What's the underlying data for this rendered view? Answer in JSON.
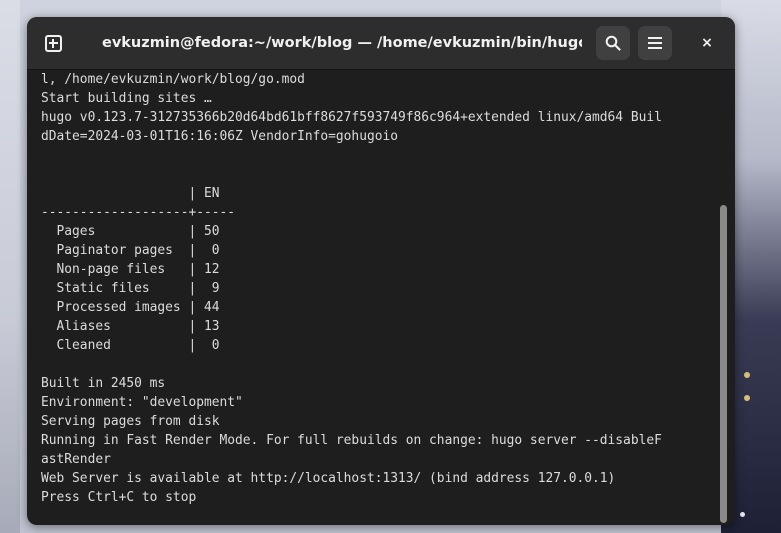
{
  "window": {
    "title": "evkuzmin@fedora:~/work/blog — /home/evkuzmin/bin/hugo se…",
    "close_label": "×"
  },
  "icons": {
    "new_tab": "new-tab-icon",
    "search": "search-icon",
    "menu": "hamburger-menu-icon",
    "close": "close-icon"
  },
  "terminal": {
    "lines": [
      "l, /home/evkuzmin/work/blog/go.mod",
      "Start building sites …",
      "hugo v0.123.7-312735366b20d64bd61bff8627f593749f86c964+extended linux/amd64 Buil",
      "dDate=2024-03-01T16:16:06Z VendorInfo=gohugoio",
      "",
      "",
      "                   | EN",
      "-------------------+-----",
      "  Pages            | 50",
      "  Paginator pages  |  0",
      "  Non-page files   | 12",
      "  Static files     |  9",
      "  Processed images | 44",
      "  Aliases          | 13",
      "  Cleaned          |  0",
      "",
      "Built in 2450 ms",
      "Environment: \"development\"",
      "Serving pages from disk",
      "Running in Fast Render Mode. For full rebuilds on change: hugo server --disableF",
      "astRender",
      "Web Server is available at http://localhost:1313/ (bind address 127.0.0.1)",
      "Press Ctrl+C to stop"
    ]
  },
  "colors": {
    "terminal_bg": "#1e1e1e",
    "headerbar_bg": "#2d2d2d",
    "text": "#dcdcdc",
    "scrollbar": "#8a8a8a"
  }
}
